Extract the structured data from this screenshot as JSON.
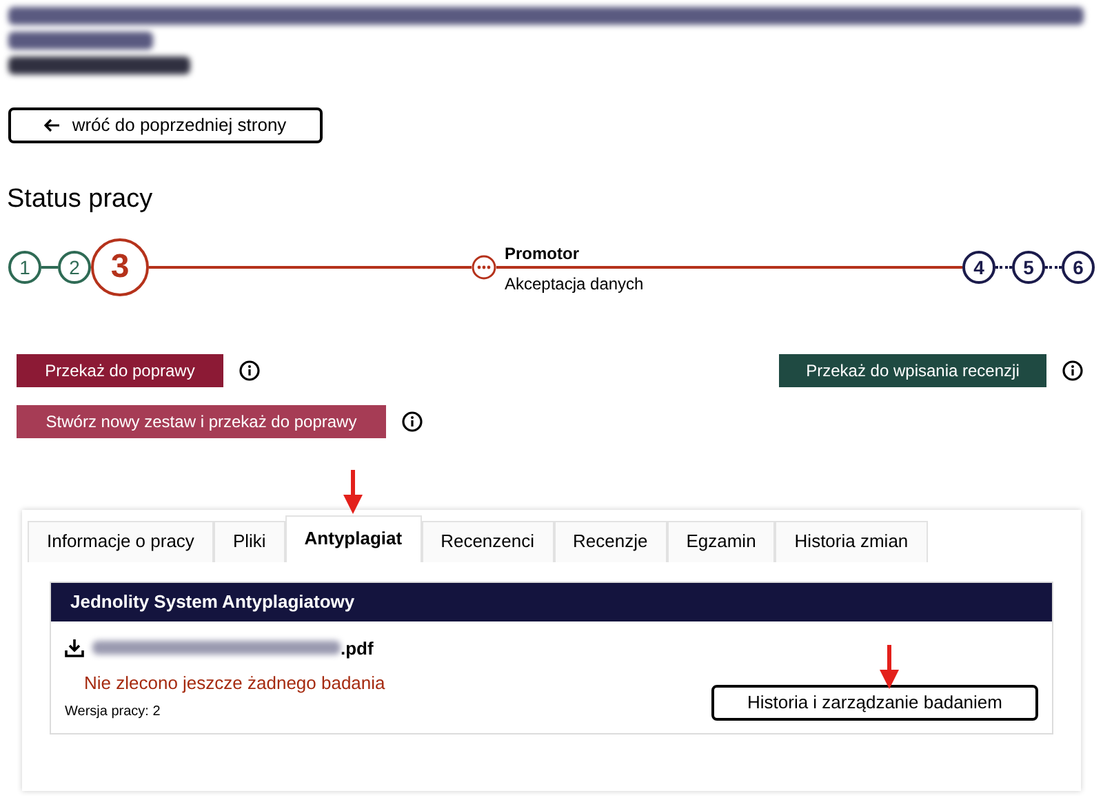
{
  "back_button": {
    "label": "wróć do poprzedniej strony"
  },
  "status": {
    "title": "Status pracy",
    "steps": [
      {
        "label": "1",
        "done": true,
        "current": false
      },
      {
        "label": "2",
        "done": true,
        "current": false
      },
      {
        "label": "3",
        "done": false,
        "current": true
      },
      {
        "label": "4",
        "done": false,
        "current": false
      },
      {
        "label": "5",
        "done": false,
        "current": false
      },
      {
        "label": "6",
        "done": false,
        "current": false
      }
    ],
    "substep": {
      "title": "Promotor",
      "subtitle": "Akceptacja danych"
    }
  },
  "actions": [
    {
      "label": "Przekaż do poprawy",
      "kind": "danger"
    },
    {
      "label": "Przekaż do wpisania recenzji",
      "kind": "success"
    },
    {
      "label": "Stwórz nowy zestaw i przekaż do poprawy",
      "kind": "danger-light"
    }
  ],
  "tabs": [
    {
      "label": "Informacje o pracy",
      "selected": false
    },
    {
      "label": "Pliki",
      "selected": false
    },
    {
      "label": "Antyplagiat",
      "selected": true
    },
    {
      "label": "Recenzenci",
      "selected": false
    },
    {
      "label": "Recenzje",
      "selected": false
    },
    {
      "label": "Egzamin",
      "selected": false
    },
    {
      "label": "Historia zmian",
      "selected": false
    }
  ],
  "panel": {
    "title": "Jednolity System Antyplagiatowy",
    "file_extension": ".pdf",
    "message": "Nie zlecono jeszcze żadnego badania",
    "version": "Wersja pracy: 2",
    "button": "Historia i zarządzanie badaniem"
  }
}
